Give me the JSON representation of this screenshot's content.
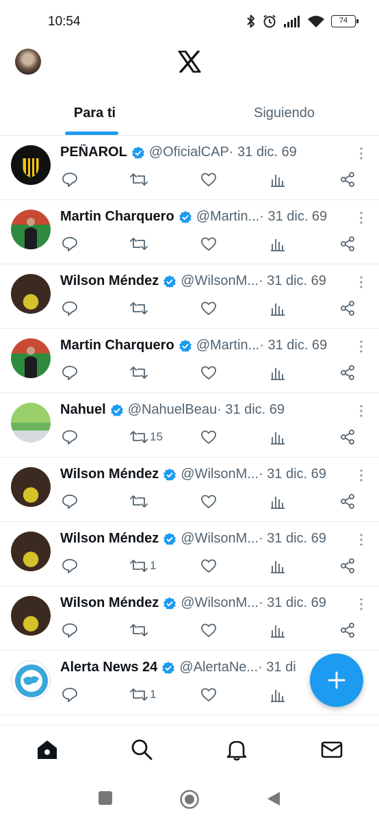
{
  "status_bar": {
    "time": "10:54",
    "battery": "74",
    "icons": [
      "bluetooth-icon",
      "alarm-icon",
      "signal-icon",
      "wifi-icon",
      "battery-icon"
    ]
  },
  "header": {
    "logo": "X"
  },
  "tabs": [
    {
      "label": "Para ti",
      "active": true
    },
    {
      "label": "Siguiendo",
      "active": false
    }
  ],
  "tweets": [
    {
      "name": "PEÑAROL",
      "handle": "@OficialCAP",
      "sep_date": " · 31 dic. 69",
      "retweets": "",
      "verified": true
    },
    {
      "name": "Martin Charquero",
      "handle": "@Martin...",
      "sep_date": " · 31 dic. 69",
      "retweets": "",
      "verified": true
    },
    {
      "name": "Wilson Méndez",
      "handle": "@WilsonM...",
      "sep_date": " · 31 dic. 69",
      "retweets": "",
      "verified": true
    },
    {
      "name": "Martin Charquero",
      "handle": "@Martin...",
      "sep_date": " · 31 dic. 69",
      "retweets": "",
      "verified": true
    },
    {
      "name": "Nahuel",
      "handle": "@NahuelBeau",
      "sep_date": " · 31 dic. 69",
      "retweets": "15",
      "verified": true
    },
    {
      "name": "Wilson Méndez",
      "handle": "@WilsonM...",
      "sep_date": " · 31 dic. 69",
      "retweets": "",
      "verified": true
    },
    {
      "name": "Wilson Méndez",
      "handle": "@WilsonM...",
      "sep_date": " · 31 dic. 69",
      "retweets": "1",
      "verified": true
    },
    {
      "name": "Wilson Méndez",
      "handle": "@WilsonM...",
      "sep_date": " · 31 dic. 69",
      "retweets": "",
      "verified": true
    },
    {
      "name": "Alerta News 24",
      "handle": "@AlertaNe...",
      "sep_date": " · 31 di",
      "retweets": "1",
      "verified": true
    }
  ],
  "bottom_nav": [
    "home-icon",
    "search-icon",
    "bell-icon",
    "mail-icon"
  ],
  "colors": {
    "accent": "#1d9bf0",
    "text": "#0f1419",
    "secondary": "#536471",
    "divider": "#e6e9ec"
  }
}
